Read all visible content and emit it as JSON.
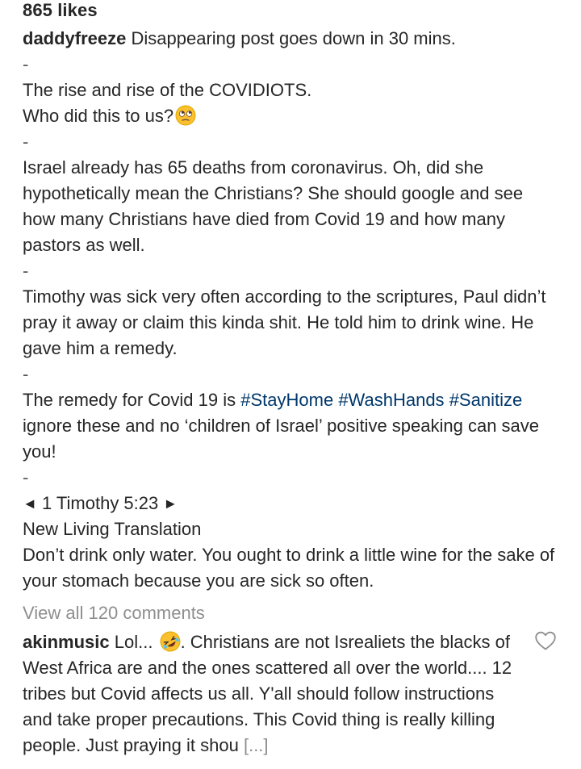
{
  "post": {
    "likes": "865 likes",
    "author": "daddyfreeze",
    "caption": {
      "line1": "Disappearing post goes down in 30 mins.",
      "sep": "-",
      "p2a": "The rise and rise of the COVIDIOTS.",
      "p2b": "Who did this to us?",
      "p3": "Israel already has 65 deaths from coronavirus. Oh, did she hypothetically mean the Christians? She should google and see how many Christians have died from Covid 19 and how many pastors as well.",
      "p4": "Timothy was sick very often according to the scriptures, Paul didn’t pray it away or claim this kinda shit. He told him to drink wine. He gave him a remedy.",
      "p5_pre": "The remedy for Covid 19 is",
      "hashtags": [
        "#StayHome",
        "#WashHands",
        "#Sanitize"
      ],
      "p5_post": "ignore these and no ‘children of Israel’ positive speaking can save you!",
      "verse_left_arrow": "◄",
      "verse_ref": "1 Timothy 5:23",
      "verse_right_arrow": "►",
      "translation": "New Living Translation",
      "verse_text": "Don’t drink only water. You ought to drink a little wine for the sake of your stomach because you are sick so often."
    },
    "emoji_1": "face-with-rolling-eyes-icon",
    "view_all_comments": "View all 120 comments"
  },
  "comment": {
    "author": "akinmusic",
    "text_pre": "Lol...",
    "emoji": "rolling-on-floor-laughing-icon",
    "text_post": ". Christians are not Isrealiets the blacks of West Africa are and the ones scattered all over the world.... 12 tribes but Covid affects us all. Y'all should follow instructions and take proper precautions. This Covid thing is really killing people. Just praying it shou",
    "more": "[...]"
  },
  "colors": {
    "text": "#262626",
    "hashtag": "#00376b",
    "muted": "#8e8e8e"
  }
}
